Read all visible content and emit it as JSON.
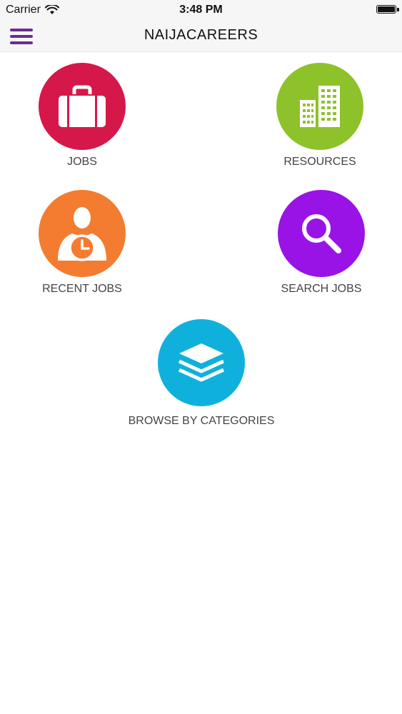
{
  "status_bar": {
    "carrier": "Carrier",
    "time": "3:48 PM"
  },
  "nav": {
    "title": "NAIJACAREERS"
  },
  "tiles": {
    "jobs": {
      "label": "JOBS",
      "color": "#d6174a",
      "icon": "briefcase-icon"
    },
    "resources": {
      "label": "RESOURCES",
      "color": "#8ec22a",
      "icon": "buildings-icon"
    },
    "recent_jobs": {
      "label": "RECENT JOBS",
      "color": "#f47c30",
      "icon": "person-clock-icon"
    },
    "search_jobs": {
      "label": "SEARCH JOBS",
      "color": "#9a13e6",
      "icon": "magnifier-icon"
    },
    "browse_categories": {
      "label": "BROWSE BY CATEGORIES",
      "color": "#0fb1dc",
      "icon": "layers-icon"
    }
  },
  "colors": {
    "menu_accent": "#6e2c91"
  }
}
